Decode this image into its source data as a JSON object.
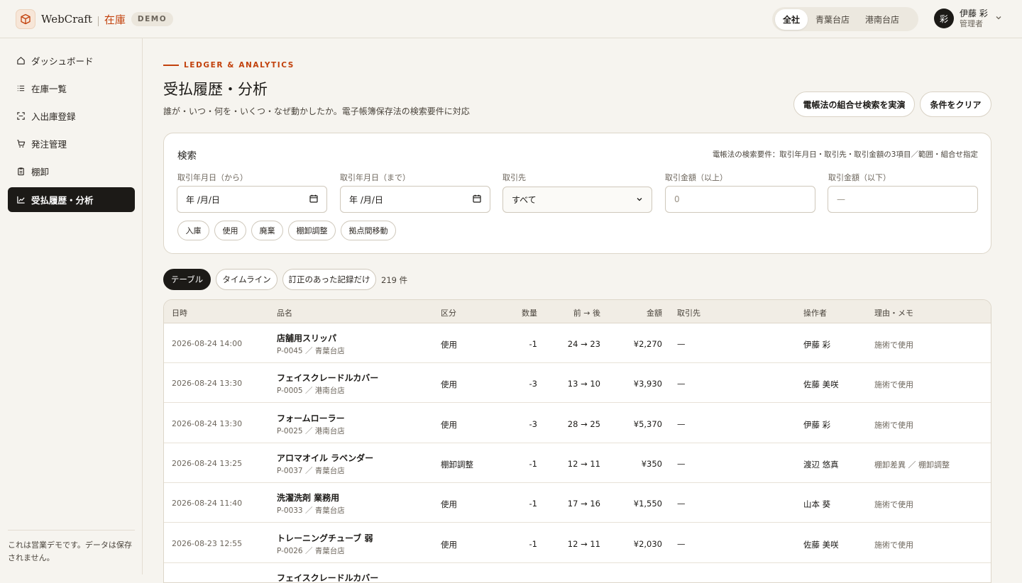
{
  "header": {
    "brand": "WebCraft",
    "brand_sub": "在庫",
    "demo_badge": "DEMO",
    "stores": [
      "全社",
      "青葉台店",
      "港南台店"
    ],
    "active_store": "全社",
    "user": {
      "initial": "彩",
      "name": "伊藤 彩",
      "role": "管理者"
    }
  },
  "sidebar": {
    "items": [
      {
        "label": "ダッシュボード",
        "icon": "home-icon"
      },
      {
        "label": "在庫一覧",
        "icon": "list-icon"
      },
      {
        "label": "入出庫登録",
        "icon": "scan-icon"
      },
      {
        "label": "発注管理",
        "icon": "cart-icon"
      },
      {
        "label": "棚卸",
        "icon": "clipboard-icon"
      },
      {
        "label": "受払履歴・分析",
        "icon": "chart-icon",
        "active": true
      }
    ],
    "footer": "これは営業デモです。データは保存されません。"
  },
  "page": {
    "eyebrow": "LEDGER & ANALYTICS",
    "title": "受払履歴・分析",
    "subtitle": "誰が・いつ・何を・いくつ・なぜ動かしたか。電子帳簿保存法の検索要件に対応",
    "actions": {
      "primary": "電帳法の組合せ検索を実演",
      "clear": "条件をクリア"
    }
  },
  "search": {
    "title": "検索",
    "hint": "電帳法の検索要件：取引年月日・取引先・取引金額の3項目／範囲・組合せ指定",
    "fields": [
      {
        "label": "取引年月日（から）",
        "value": "年 /月/日"
      },
      {
        "label": "取引年月日（まで）",
        "value": "年 /月/日"
      },
      {
        "label": "取引先",
        "value": "すべて"
      },
      {
        "label": "取引金額（以上）",
        "value": "0"
      },
      {
        "label": "取引金額（以下）",
        "value": "—"
      }
    ],
    "chips": [
      "入庫",
      "使用",
      "廃棄",
      "棚卸調整",
      "拠点間移動"
    ]
  },
  "views": {
    "tabs": [
      "テーブル",
      "タイムライン",
      "訂正のあった記録だけ"
    ],
    "active": "テーブル",
    "count": "219 件"
  },
  "table": {
    "headers": [
      "日時",
      "品名",
      "区分",
      "数量",
      "前 → 後",
      "金額",
      "取引先",
      "操作者",
      "理由・メモ"
    ],
    "rows": [
      {
        "datetime": "2026-08-24 14:00",
        "name": "店舗用スリッパ",
        "code": "P-0045 ／ 青葉台店",
        "type": "使用",
        "qty": "-1",
        "change": "24 → 23",
        "amount": "¥2,270",
        "partner": "—",
        "operator": "伊藤 彩",
        "memo": "施術で使用"
      },
      {
        "datetime": "2026-08-24 13:30",
        "name": "フェイスクレードルカバー",
        "code": "P-0005 ／ 港南台店",
        "type": "使用",
        "qty": "-3",
        "change": "13 → 10",
        "amount": "¥3,930",
        "partner": "—",
        "operator": "佐藤 美咲",
        "memo": "施術で使用"
      },
      {
        "datetime": "2026-08-24 13:30",
        "name": "フォームローラー",
        "code": "P-0025 ／ 港南台店",
        "type": "使用",
        "qty": "-3",
        "change": "28 → 25",
        "amount": "¥5,370",
        "partner": "—",
        "operator": "伊藤 彩",
        "memo": "施術で使用"
      },
      {
        "datetime": "2026-08-24 13:25",
        "name": "アロマオイル ラベンダー",
        "code": "P-0037 ／ 青葉台店",
        "type": "棚卸調整",
        "qty": "-1",
        "change": "12 → 11",
        "amount": "¥350",
        "partner": "—",
        "operator": "渡辺 悠真",
        "memo": "棚卸差異 ／ 棚卸調整"
      },
      {
        "datetime": "2026-08-24 11:40",
        "name": "洗濯洗剤 業務用",
        "code": "P-0033 ／ 青葉台店",
        "type": "使用",
        "qty": "-1",
        "change": "17 → 16",
        "amount": "¥1,550",
        "partner": "—",
        "operator": "山本 葵",
        "memo": "施術で使用"
      },
      {
        "datetime": "2026-08-23 12:55",
        "name": "トレーニングチューブ 弱",
        "code": "P-0026 ／ 青葉台店",
        "type": "使用",
        "qty": "-1",
        "change": "12 → 11",
        "amount": "¥2,030",
        "partner": "—",
        "operator": "佐藤 美咲",
        "memo": "施術で使用"
      },
      {
        "datetime": "",
        "name": "フェイスクレードルカバー",
        "code": "",
        "type": "",
        "qty": "",
        "change": "",
        "amount": "",
        "partner": "",
        "operator": "",
        "memo": ""
      }
    ]
  },
  "colors": {
    "accent": "#c2410c",
    "ink": "#1c1a17",
    "background": "#f6f4ef"
  }
}
